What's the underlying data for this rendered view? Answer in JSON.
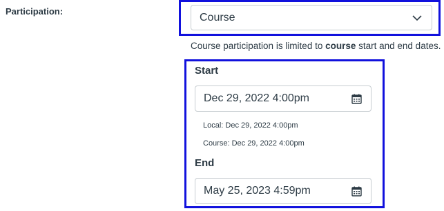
{
  "participation": {
    "label": "Participation:",
    "selected": "Course",
    "hint_prefix": "Course participation is limited to ",
    "hint_bold": "course",
    "hint_suffix": " start and end dates."
  },
  "start": {
    "title": "Start",
    "value": "Dec 29, 2022 4:00pm",
    "local": "Local: Dec 29, 2022 4:00pm",
    "course": "Course: Dec 29, 2022 4:00pm"
  },
  "end": {
    "title": "End",
    "value": "May 25, 2023 4:59pm"
  },
  "icons": {
    "select": "chevron-down-icon",
    "date": "calendar-icon"
  },
  "colors": {
    "highlight": "#1111dd",
    "text": "#2d3b45",
    "border": "#c7cdd1"
  }
}
